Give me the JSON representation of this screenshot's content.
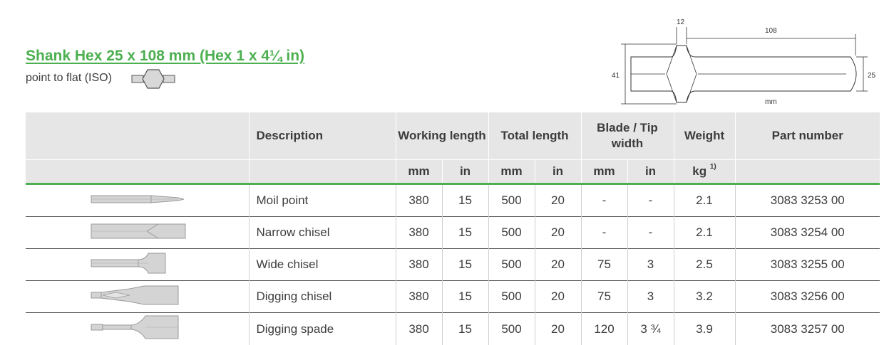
{
  "header": {
    "title": "Shank Hex 25 x 108 mm (Hex 1 x 4¼ in)",
    "subtitle": "point to flat (ISO)",
    "hex_icon": "hex-shank-icon"
  },
  "diagram": {
    "label_collar": "12",
    "label_length": "108",
    "label_diameter": "41",
    "label_hex": "25",
    "label_unit": "mm"
  },
  "table": {
    "columns": {
      "description": "Description",
      "working_length": "Working length",
      "total_length": "Total length",
      "blade_tip_width": "Blade / Tip width",
      "weight": "Weight",
      "part_number": "Part number"
    },
    "units": {
      "mm": "mm",
      "in": "in",
      "kg": "kg",
      "kg_note": "1)"
    },
    "rows": [
      {
        "icon": "moil-point-icon",
        "description": "Moil point",
        "wl_mm": "380",
        "wl_in": "15",
        "tl_mm": "500",
        "tl_in": "20",
        "bw_mm": "-",
        "bw_in": "-",
        "weight": "2.1",
        "part": "3083 3253 00"
      },
      {
        "icon": "narrow-chisel-icon",
        "description": "Narrow chisel",
        "wl_mm": "380",
        "wl_in": "15",
        "tl_mm": "500",
        "tl_in": "20",
        "bw_mm": "-",
        "bw_in": "-",
        "weight": "2.1",
        "part": "3083 3254 00"
      },
      {
        "icon": "wide-chisel-icon",
        "description": "Wide chisel",
        "wl_mm": "380",
        "wl_in": "15",
        "tl_mm": "500",
        "tl_in": "20",
        "bw_mm": "75",
        "bw_in": "3",
        "weight": "2.5",
        "part": "3083 3255 00"
      },
      {
        "icon": "digging-chisel-icon",
        "description": "Digging chisel",
        "wl_mm": "380",
        "wl_in": "15",
        "tl_mm": "500",
        "tl_in": "20",
        "bw_mm": "75",
        "bw_in": "3",
        "weight": "3.2",
        "part": "3083 3256 00"
      },
      {
        "icon": "digging-spade-icon",
        "description": "Digging spade",
        "wl_mm": "380",
        "wl_in": "15",
        "tl_mm": "500",
        "tl_in": "20",
        "bw_mm": "120",
        "bw_in": "3 ¾",
        "weight": "3.9",
        "part": "3083 3257 00"
      }
    ]
  },
  "colors": {
    "accent": "#4caf50",
    "header_bg": "#e6e6e6",
    "text": "#3c3c3c"
  }
}
